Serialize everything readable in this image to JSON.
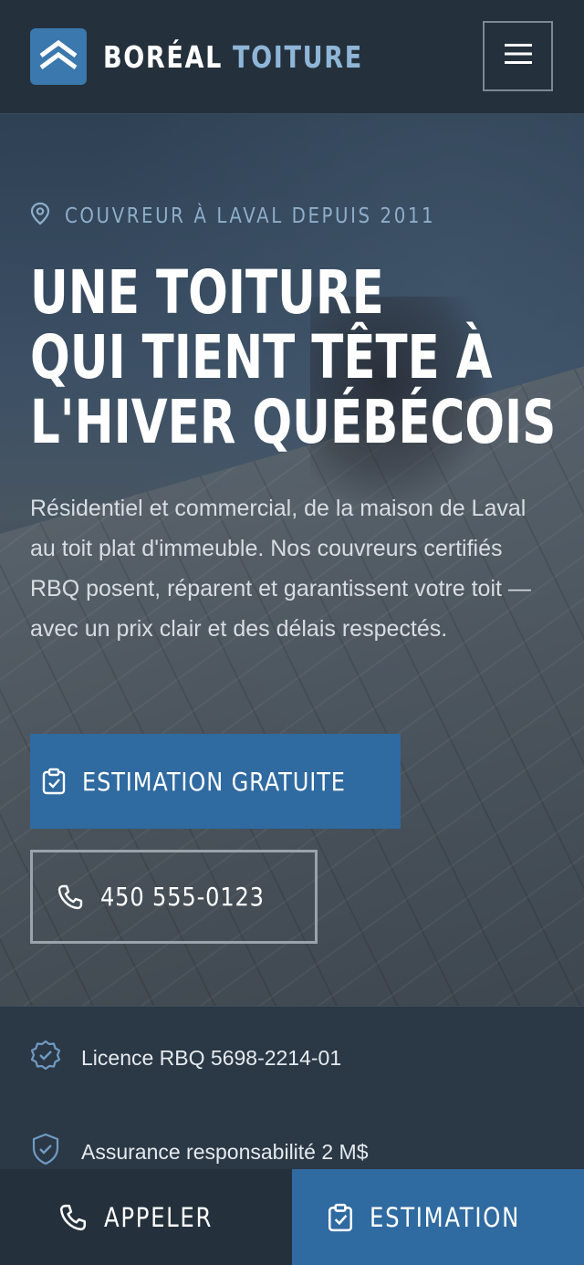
{
  "header": {
    "brand_part1": "BORÉAL",
    "brand_part2": "TOITURE",
    "logo_icon": "roof-chevron-icon",
    "menu_icon": "hamburger-menu-icon"
  },
  "hero": {
    "tagline": "COUVREUR À LAVAL DEPUIS 2011",
    "tagline_icon": "map-pin-icon",
    "title_lines": [
      "UNE TOITURE",
      "QUI TIENT TÊTE À",
      "L'HIVER QUÉBÉCOIS"
    ],
    "lead": "Résidentiel et commercial, de la maison de Laval au toit plat d'immeuble. Nos couvreurs certifiés RBQ posent, réparent et garantissent votre toit — avec un prix clair et des délais respectés.",
    "primary_cta": "ESTIMATION GRATUITE",
    "primary_cta_icon": "clipboard-check-icon",
    "phone_cta": "450 555-0123",
    "phone_icon": "phone-icon"
  },
  "trust": {
    "items": [
      {
        "label": "Licence RBQ 5698-2214-01",
        "icon": "badge-check-icon"
      },
      {
        "label": "Assurance responsabilité 2 M$",
        "icon": "shield-check-icon"
      }
    ]
  },
  "bottom_bar": {
    "call_label": "APPELER",
    "estimate_label": "ESTIMATION"
  },
  "colors": {
    "accent": "#2f6aa0",
    "accent_light": "#8fb6d8",
    "header_bg": "#24303b",
    "panel_bg": "#2b3845"
  }
}
